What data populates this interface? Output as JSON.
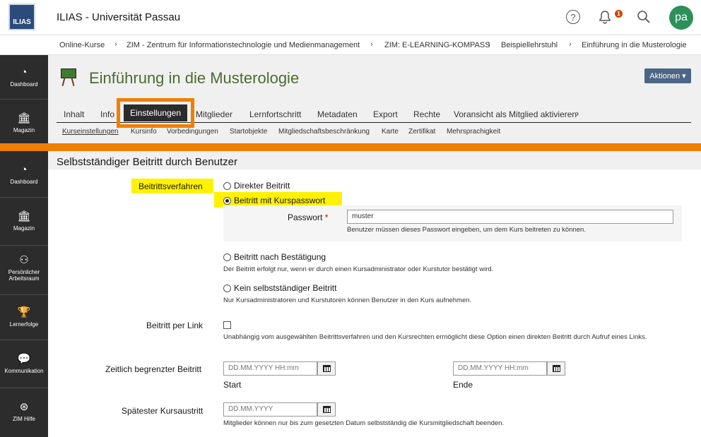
{
  "header": {
    "logo_text": "ILIAS",
    "brand": "ILIAS - Universität Passau",
    "notification_count": "1",
    "avatar_initials": "pa"
  },
  "breadcrumb": [
    "Online-Kurse",
    "ZIM - Zentrum für Informationstechnologie und Medienmanagement",
    "ZIM: E-LEARNING-KOMPASS",
    "Beispiellehrstuhl",
    "Einführung in die Musterologie"
  ],
  "sidebar_top": [
    {
      "label": "Dashboard",
      "icon": "gauge-icon"
    },
    {
      "label": "Magazin",
      "icon": "building-icon"
    }
  ],
  "sidebar_bottom": [
    {
      "label": "Dashboard",
      "icon": "gauge-icon"
    },
    {
      "label": "Magazin",
      "icon": "building-icon"
    },
    {
      "label": "Persönlicher Arbeitsraum",
      "icon": "person-icon"
    },
    {
      "label": "Lernerfolge",
      "icon": "trophy-icon"
    },
    {
      "label": "Kommunikation",
      "icon": "chat-icon"
    },
    {
      "label": "ZIM Hilfe",
      "icon": "lifebuoy-icon"
    }
  ],
  "course": {
    "title": "Einführung in die Musterologie",
    "actions_label": "Aktionen ▾"
  },
  "tabs": [
    "Inhalt",
    "Info",
    "Einstellungen",
    "Mitglieder",
    "Lernfortschritt",
    "Metadaten",
    "Export",
    "Rechte",
    "Voransicht als Mitglied aktivieren"
  ],
  "active_tab": "Einstellungen",
  "subtabs": [
    "Kurseinstellungen",
    "Kursinfo",
    "Vorbedingungen",
    "Startobjekte",
    "Mitgliedschaftsbeschränkung",
    "Karte",
    "Zertifikat",
    "Mehrsprachigkeit"
  ],
  "form": {
    "title": "Selbstständiger Beitritt durch Benutzer",
    "join_method_label": "Beitrittsverfahren",
    "options": {
      "direct": "Direkter Beitritt",
      "password": "Beitritt mit Kurspasswort",
      "confirmation": "Beitritt nach Bestätigung",
      "none": "Kein selbstständiger Beitritt"
    },
    "password_label": "Passwort",
    "password_required": "*",
    "password_value": "muster",
    "password_hint": "Benutzer müssen dieses Passwort eingeben, um dem Kurs beitreten zu können.",
    "confirmation_hint": "Der Beitritt erfolgt nur, wenn er durch einen Kursadministrator oder Kurstutor bestätigt wird.",
    "none_hint": "Nur Kursadministratoren und Kurstutoren können Benutzer in den Kurs aufnehmen.",
    "link_label": "Beitritt per Link",
    "link_hint": "Unabhängig vom ausgewählten Beitrittsverfahren und den Kursrechten ermöglicht diese Option einen direkten Beitritt durch Aufruf eines Links.",
    "limited_label": "Zeitlich begrenzter Beitritt",
    "datetime_placeholder": "DD.MM.YYYY HH:mm",
    "start_label": "Start",
    "end_label": "Ende",
    "leave_label": "Spätester Kursaustritt",
    "date_placeholder": "DD.MM.YYYY",
    "leave_hint": "Mitglieder können nur bis zum gesetzten Datum selbstständig die Kursmitgliedschaft beenden."
  }
}
